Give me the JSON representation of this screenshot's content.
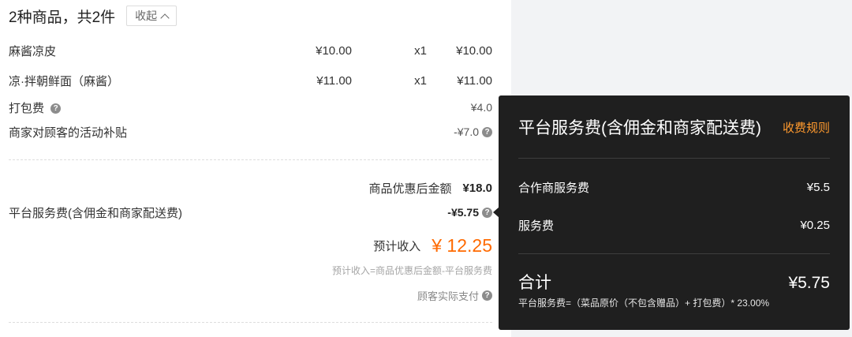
{
  "order": {
    "summary_title": "2种商品，共2件",
    "collapse_label": "收起"
  },
  "items": [
    {
      "name": "麻酱凉皮",
      "price": "¥10.00",
      "qty": "x1",
      "total": "¥10.00"
    },
    {
      "name": "凉·拌朝鲜面（麻酱）",
      "price": "¥11.00",
      "qty": "x1",
      "total": "¥11.00"
    }
  ],
  "fees": {
    "packing_label": "打包费",
    "packing_value": "¥4.0",
    "subsidy_label": "商家对顾客的活动补贴",
    "subsidy_value": "-¥7.0"
  },
  "totals": {
    "discounted_label": "商品优惠后金额",
    "discounted_value": "¥18.0",
    "service_fee_label": "平台服务费(含佣金和商家配送费)",
    "service_fee_value": "-¥5.75",
    "estimated_income_label": "预计收入",
    "estimated_income_value": "¥ 12.25",
    "formula_note": "预计收入=商品优惠后金额-平台服务费",
    "customer_paid_label": "顾客实际支付"
  },
  "popover": {
    "title": "平台服务费(含佣金和商家配送费)",
    "rules_link": "收费规则",
    "rows": [
      {
        "label": "合作商服务费",
        "value": "¥5.5"
      },
      {
        "label": "服务费",
        "value": "¥0.25"
      }
    ],
    "total_label": "合计",
    "total_value": "¥5.75",
    "formula": "平台服务费=（菜品原价（不包含赠品）+ 打包费）* 23.00%"
  },
  "colors": {
    "accent_orange": "#ff6a00",
    "link_orange": "#ff9a2e",
    "popover_bg": "#1f1f1f",
    "side_bg": "#f2f3f5"
  },
  "icons": {
    "help": "question-circle-icon",
    "collapse": "chevron-up-icon"
  }
}
